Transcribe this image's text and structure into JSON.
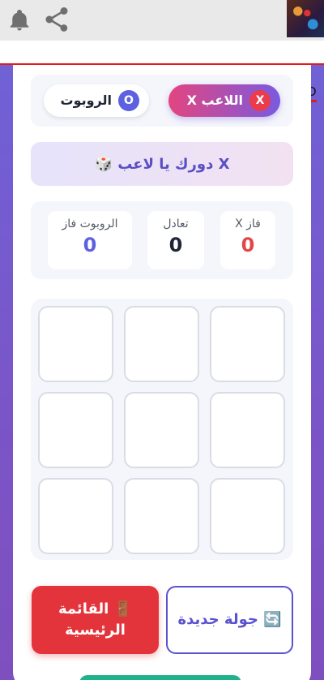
{
  "topbar": {
    "notification_icon": "bell-icon",
    "share_icon": "share-icon",
    "app_label": "X.O",
    "add_icon": "plus-icon"
  },
  "players": {
    "player": {
      "badge": "X",
      "name": "اللاعب X"
    },
    "robot": {
      "badge": "O",
      "name": "الروبوت"
    }
  },
  "turn": {
    "text": "🎲 دورك يا لاعب X"
  },
  "scores": {
    "x_wins": {
      "label": "X فاز",
      "value": "0",
      "color": "#e04848"
    },
    "draws": {
      "label": "تعادل",
      "value": "0",
      "color": "#1f2533"
    },
    "robot_wins": {
      "label": "الروبوت فاز",
      "value": "0",
      "color": "#5d61e0"
    }
  },
  "board": {
    "cells": [
      "",
      "",
      "",
      "",
      "",
      "",
      "",
      "",
      ""
    ]
  },
  "buttons": {
    "home": "🚪 القائمة الرئيسية",
    "new_round": "🔄 جولة جديدة"
  },
  "colors": {
    "accent": "#5b51cf",
    "danger": "#e3343b",
    "background_gradient_start": "#6e64d8",
    "background_gradient_end": "#7e4fbf"
  }
}
